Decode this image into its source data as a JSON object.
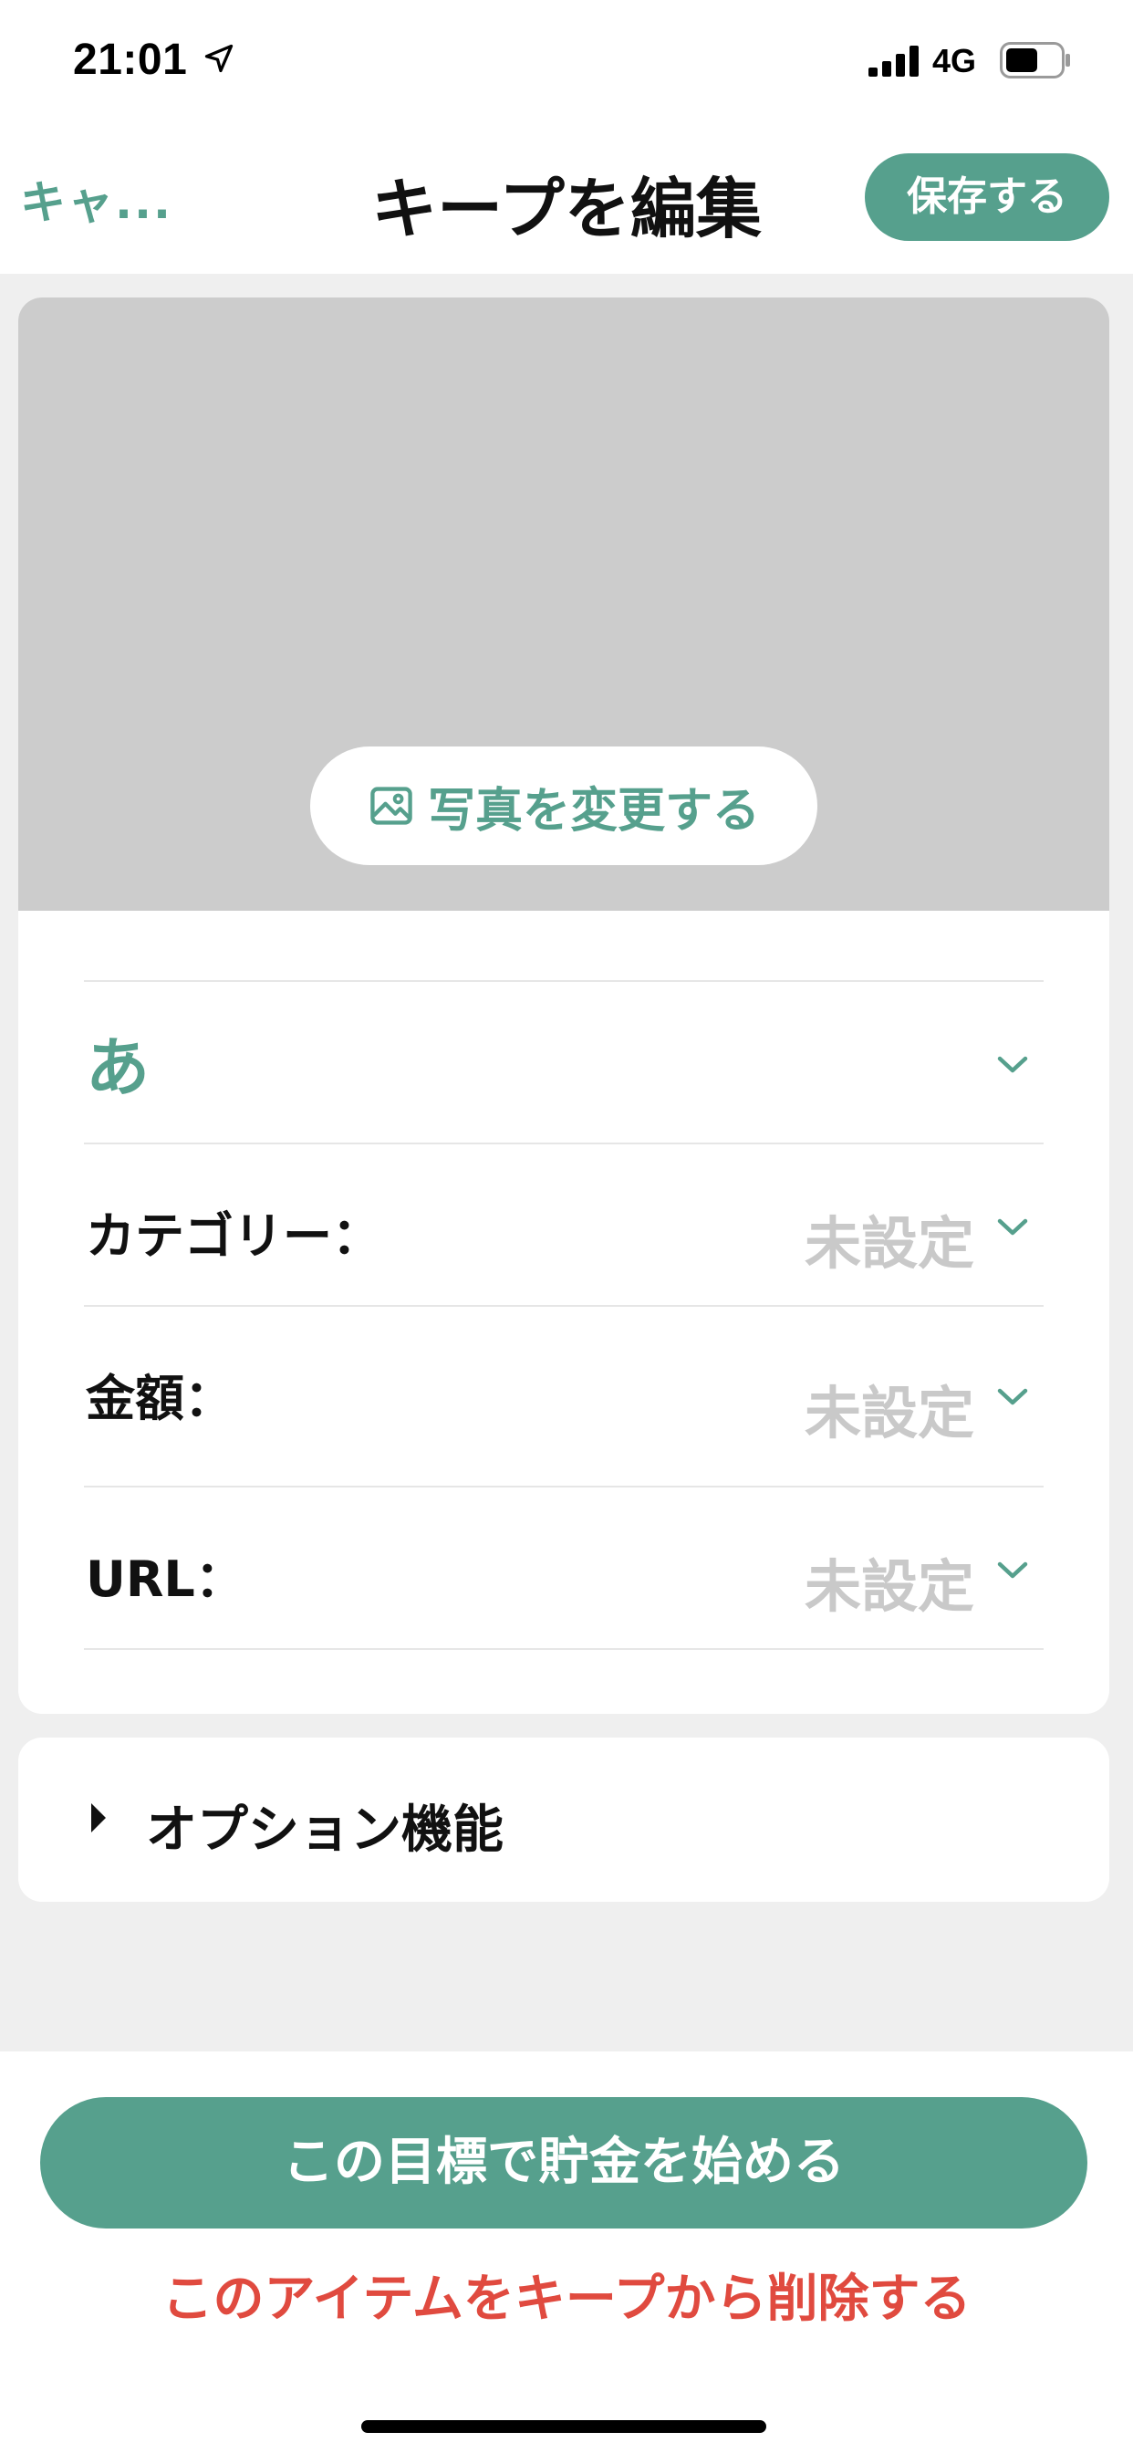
{
  "status_bar": {
    "time": "21:01",
    "network": "4G",
    "icons": [
      "location-arrow-icon",
      "signal-icon",
      "battery-icon"
    ]
  },
  "nav": {
    "cancel_label": "キャ...",
    "title": "キープを編集",
    "save_label": "保存する"
  },
  "photo": {
    "change_label": "写真を変更する",
    "icon": "image-icon"
  },
  "form": {
    "name_value": "あ",
    "category_label": "カテゴリー：",
    "category_value": "未設定",
    "amount_label": "金額：",
    "amount_value": "未設定",
    "url_label": "URL：",
    "url_value": "未設定"
  },
  "options": {
    "label": "オプション機能"
  },
  "actions": {
    "start_label": "この目標で貯金を始める",
    "delete_label": "このアイテムをキープから削除する"
  },
  "colors": {
    "accent": "#56a08d",
    "danger": "#e04a3f",
    "placeholder": "#c9c9c9",
    "photo_bg": "#cccccc",
    "page_bg": "#efefef"
  }
}
